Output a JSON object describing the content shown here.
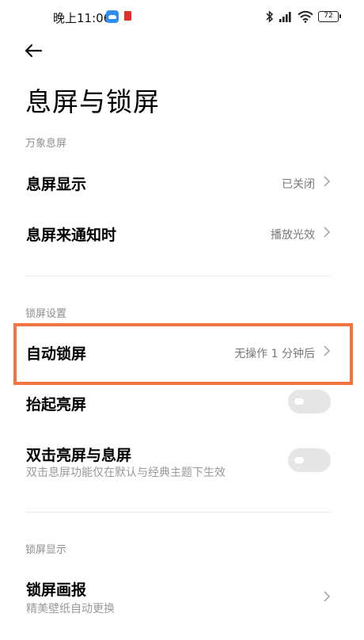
{
  "status_bar": {
    "time": "晚上11:06",
    "battery": "72"
  },
  "header": {
    "title": "息屏与锁屏"
  },
  "sections": [
    {
      "label": "万象息屏",
      "items": [
        {
          "title": "息屏显示",
          "value": "已关闭"
        },
        {
          "title": "息屏来通知时",
          "value": "播放光效"
        }
      ]
    },
    {
      "label": "锁屏设置",
      "items": [
        {
          "title": "自动锁屏",
          "value": "无操作 1 分钟后"
        },
        {
          "title": "抬起亮屏",
          "toggle": "off"
        },
        {
          "title": "双击亮屏与息屏",
          "subtitle": "双击息屏功能仅在默认与经典主题下生效",
          "toggle": "off"
        }
      ]
    },
    {
      "label": "锁屏显示",
      "items": [
        {
          "title": "锁屏画报",
          "subtitle": "精美壁纸自动更换"
        }
      ]
    }
  ],
  "colors": {
    "highlight_border": "#f0753e",
    "toggle_off_track": "#e6e6e6",
    "secondary_text": "#8e8e8e"
  }
}
